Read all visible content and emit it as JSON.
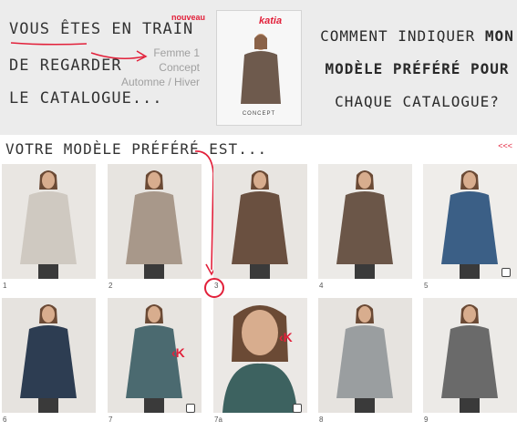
{
  "header": {
    "intro_line1": "VOUS ÊTES EN TRAIN",
    "intro_line2": "DE REGARDER",
    "intro_line3": "LE CATALOGUE...",
    "badge_new": "nouveau",
    "catalogue_name_1": "Femme 1",
    "catalogue_name_2": "Concept",
    "catalogue_season": "Automne / Hiver",
    "cover_brand": "katia",
    "cover_title": "CONCEPT",
    "question_part1": "COMMENT INDIQUER ",
    "question_bold1": "MON",
    "question_bold2": "MODÈLE PRÉFÉRÉ POUR",
    "question_part3": "CHAQUE CATALOGUE?"
  },
  "section": {
    "favorite_label": "VOTRE MODÈLE PRÉFÉRÉ EST...",
    "nav_back": "<<<"
  },
  "models": [
    {
      "label": "1",
      "garment": "#cfc9c1",
      "bg": "#e9e6e2"
    },
    {
      "label": "2",
      "garment": "#a8988a",
      "bg": "#e7e4e0"
    },
    {
      "label": "3",
      "garment": "#6a5040",
      "bg": "#e8e5e1"
    },
    {
      "label": "4",
      "garment": "#6b5648",
      "bg": "#eceae7"
    },
    {
      "label": "5",
      "garment": "#3b5f86",
      "bg": "#efedea"
    },
    {
      "label": "6",
      "garment": "#2d3d52",
      "bg": "#e6e3df"
    },
    {
      "label": "7",
      "garment": "#4b6a70",
      "bg": "#e7e4e0"
    },
    {
      "label": "7a",
      "garment": "#3d6260",
      "bg": "#ebe8e5"
    },
    {
      "label": "8",
      "garment": "#9a9ea0",
      "bg": "#e6e3df"
    },
    {
      "label": "9",
      "garment": "#6a6a6a",
      "bg": "#eceae7"
    }
  ],
  "colors": {
    "accent": "#e2203a",
    "band": "#ececec"
  }
}
